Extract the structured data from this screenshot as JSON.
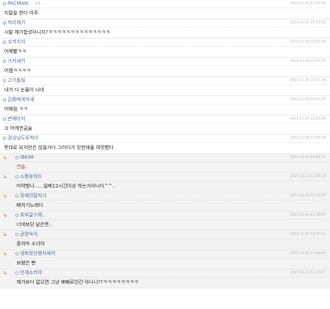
{
  "comments": [
    {
      "nick": "PACMAN.",
      "plus": "+1",
      "time": "2013.12.20 22:52:50",
      "text": "지랄을 한다 아주",
      "reply": false
    },
    {
      "nick": "하리재기",
      "plus": "",
      "time": "2013.12.20 22:53:02",
      "text": "시발 제가합성아니지?ㅋㅋㅋㅋㅋㅋㅋㅋㅋㅋㅋㅋㅋㅋ",
      "reply": false
    },
    {
      "nick": "꼬끼치치",
      "plus": "",
      "time": "2013.12.20 22:53:01",
      "text": "어제빨ㅋㅋ",
      "reply": false
    },
    {
      "nick": "가카새키",
      "plus": "",
      "time": "2013.12.20 22:53:16",
      "text": "어캠ㅋㅋㅋㅋ",
      "reply": false
    },
    {
      "nick": "고기틀림",
      "plus": "",
      "time": "2013.12.20 22:53:34",
      "text": "내가 다 눈물이 나네",
      "reply": false
    },
    {
      "nick": "김중매게끼새",
      "plus": "",
      "time": "2013.12.20 22:53:07",
      "text": "어메점 ㅋㅋ",
      "reply": false
    },
    {
      "nick": "변재타자",
      "plus": "",
      "time": "2013.12.20 22:53:45",
      "text": "크 어캐연금술",
      "reply": false
    },
    {
      "nick": "경상남도토박이",
      "plus": "",
      "time": "2013.12.20 22:00:24",
      "text": "뜻대로 되지만은 않을거다 그러다가 망한애들 여럿봤다",
      "reply": false
    },
    {
      "nick": "IBE48",
      "plus": "",
      "time": "2013.12.20 22:02:51",
      "text": "연솔",
      "reply": true,
      "red": true
    },
    {
      "nick": "쇼퐁웅워드",
      "plus": "",
      "time": "2013.12.20 22:09:29",
      "text": "미약했나......일베12시간이상 하는거아니다^^..",
      "reply": true
    },
    {
      "nick": "장애인탈지기",
      "plus": "",
      "time": "2013.12.20 22:15:05",
      "text": "삐치기노레다",
      "reply": true
    },
    {
      "nick": "호부글스웨..",
      "plus": "",
      "time": "2013.12.20 22:19:07",
      "text": "너네보단 낱은뜻..",
      "reply": true
    },
    {
      "nick": "권양숙이",
      "plus": "",
      "time": "2013.12.20 22:03:31",
      "text": "흘지마 소녀야",
      "reply": true
    },
    {
      "nick": "냉퇴정신병자새끼",
      "plus": "",
      "time": "2013.12.20 22:08:29",
      "text": "보람은 삔",
      "reply": true
    },
    {
      "nick": "언개소리야",
      "plus": "",
      "time": "2013.12.20 22:10:07",
      "text": "제가보다 없으면 그냥 뽀빠로인간 아니니??ㅋㅋㅋㅋㅋㅋㅋㅋ",
      "reply": true
    }
  ],
  "colors": {
    "nick": "#4c6a93",
    "time": "#b4b4b4",
    "reply_bg": "#f3f3f3",
    "arrow": "#e07b39"
  }
}
